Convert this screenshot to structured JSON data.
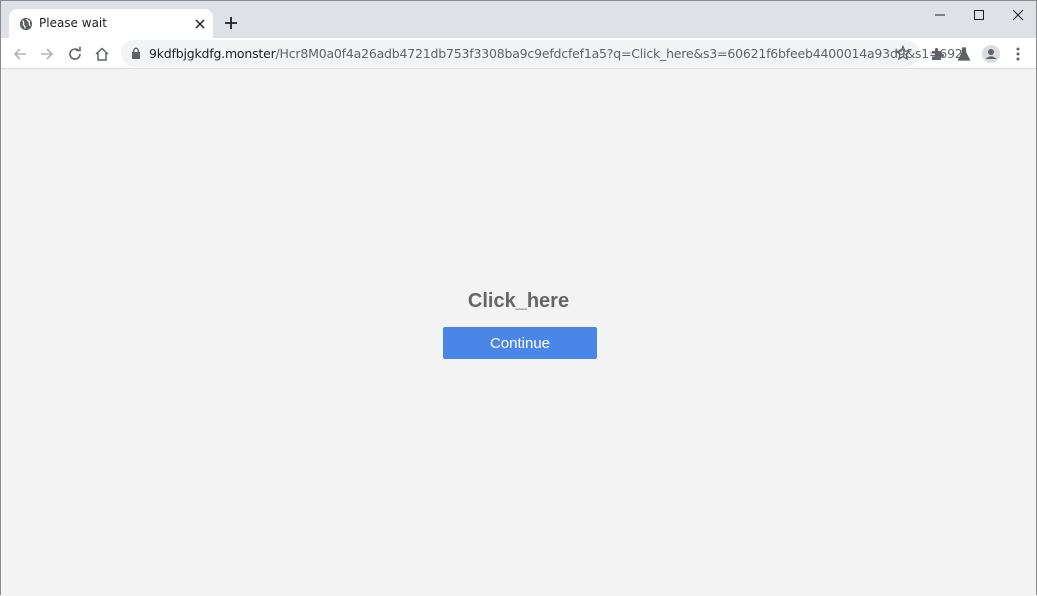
{
  "browser": {
    "tab": {
      "title": "Please wait",
      "icon": "globe-icon"
    },
    "new_tab_icon": "plus-icon",
    "window_controls": [
      "minimize-icon",
      "maximize-icon",
      "close-icon"
    ],
    "address": {
      "host": "9kdfbjgkdfg.monster",
      "path": "/Hcr8M0a0f4a26adb4721db753f3308ba9c9efdcfef1a5?q=Click_here&s3=60621f6bfeeb4400014a93d9&s1=692",
      "secure_icon": "lock-icon"
    },
    "toolbar_icons": [
      "back-icon",
      "forward-icon",
      "reload-icon",
      "home-icon",
      "star-icon",
      "extensions-icon",
      "labs-icon",
      "profile-icon",
      "menu-icon"
    ]
  },
  "page": {
    "heading": "Click_here",
    "button_label": "Continue"
  }
}
